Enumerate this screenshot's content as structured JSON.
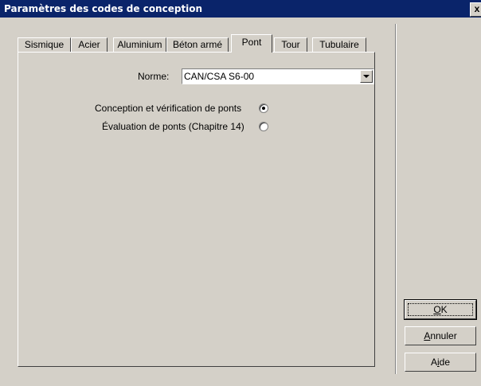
{
  "window": {
    "title": "Paramètres des codes de conception",
    "close_label": "x"
  },
  "tabs": [
    {
      "label": "Sismique",
      "active": false
    },
    {
      "label": "Acier",
      "active": false
    },
    {
      "label": "Aluminium",
      "active": false
    },
    {
      "label": "Béton armé",
      "active": false
    },
    {
      "label": "Pont",
      "active": true
    },
    {
      "label": "Tour",
      "active": false
    },
    {
      "label": "Tubulaire",
      "active": false
    }
  ],
  "form": {
    "norme_label": "Norme:",
    "norme_value": "CAN/CSA S6-00",
    "options": [
      {
        "label": "Conception et vérification de ponts",
        "checked": true
      },
      {
        "label": "Évaluation de ponts (Chapitre 14)",
        "checked": false
      }
    ]
  },
  "buttons": {
    "ok_prefix": "",
    "ok_mnemonic": "O",
    "ok_rest": "K",
    "cancel_mnemonic": "A",
    "cancel_rest": "nnuler",
    "help_prefix": "A",
    "help_mnemonic": "i",
    "help_rest": "de"
  }
}
